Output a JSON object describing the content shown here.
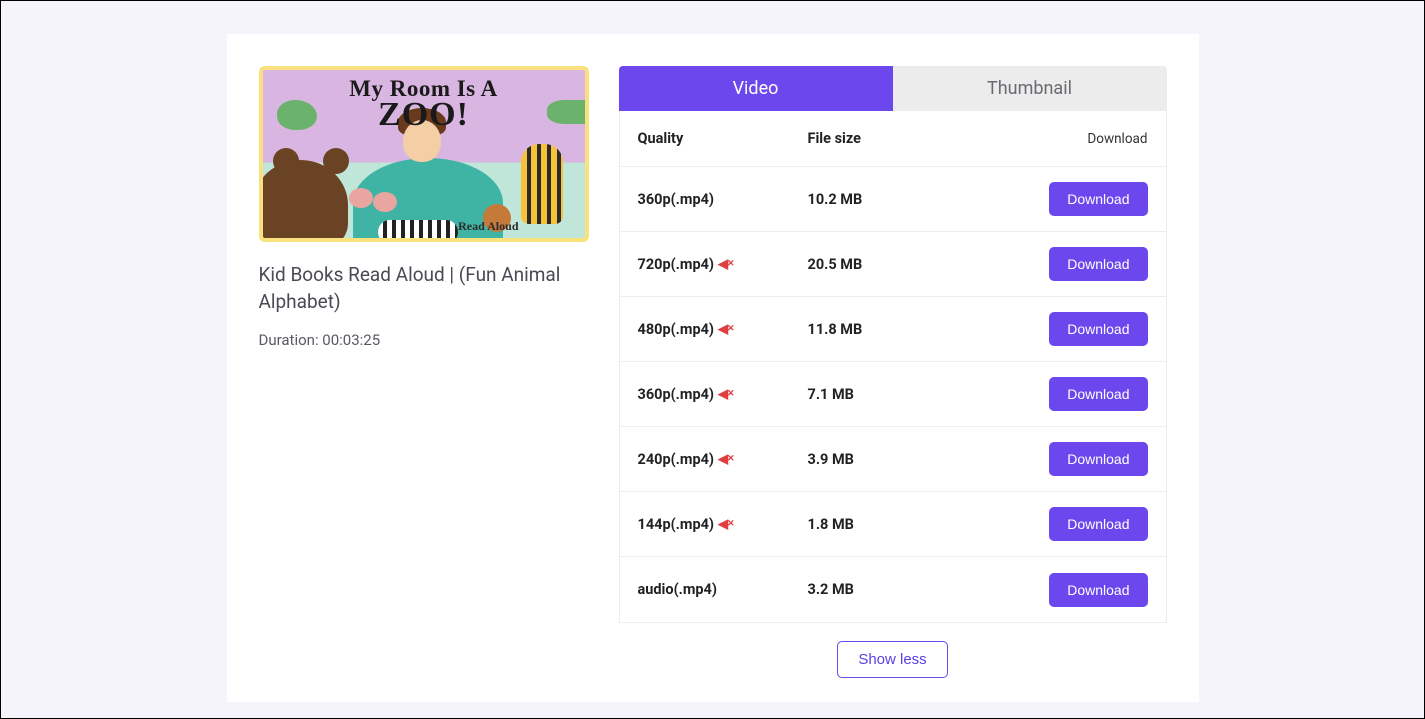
{
  "thumbnail": {
    "line1": "My Room Is A",
    "line2": "ZOO!",
    "readAloud": "Read Aloud"
  },
  "video": {
    "title": "Kid Books Read Aloud | (Fun Animal Alphabet)",
    "duration": "Duration: 00:03:25"
  },
  "tabs": {
    "video": "Video",
    "thumbnail": "Thumbnail"
  },
  "headers": {
    "quality": "Quality",
    "fileSize": "File size",
    "download": "Download"
  },
  "downloadLabel": "Download",
  "showLess": "Show less",
  "rows": [
    {
      "quality": "360p(.mp4)",
      "muted": false,
      "size": "10.2 MB"
    },
    {
      "quality": "720p(.mp4)",
      "muted": true,
      "size": "20.5 MB"
    },
    {
      "quality": "480p(.mp4)",
      "muted": true,
      "size": "11.8 MB"
    },
    {
      "quality": "360p(.mp4)",
      "muted": true,
      "size": "7.1 MB"
    },
    {
      "quality": "240p(.mp4)",
      "muted": true,
      "size": "3.9 MB"
    },
    {
      "quality": "144p(.mp4)",
      "muted": true,
      "size": "1.8 MB"
    },
    {
      "quality": "audio(.mp4)",
      "muted": false,
      "size": "3.2 MB"
    }
  ]
}
